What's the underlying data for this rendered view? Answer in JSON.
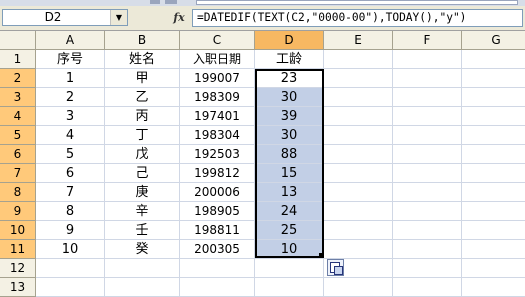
{
  "name_box": {
    "value": "D2",
    "dropdown_glyph": "▼"
  },
  "formula_bar": {
    "fx_label": "fx",
    "formula": "=DATEDIF(TEXT(C2,\"0000-00\"),TODAY(),\"y\")"
  },
  "columns": [
    "A",
    "B",
    "C",
    "D",
    "E",
    "F",
    "G"
  ],
  "header_row": [
    "序号",
    "姓名",
    "入职日期",
    "工龄"
  ],
  "rows": [
    [
      "1",
      "甲",
      "199007",
      "23"
    ],
    [
      "2",
      "乙",
      "198309",
      "30"
    ],
    [
      "3",
      "丙",
      "197401",
      "39"
    ],
    [
      "4",
      "丁",
      "198304",
      "30"
    ],
    [
      "5",
      "戊",
      "192503",
      "88"
    ],
    [
      "6",
      "己",
      "199812",
      "15"
    ],
    [
      "7",
      "庚",
      "200006",
      "13"
    ],
    [
      "8",
      "辛",
      "198905",
      "24"
    ],
    [
      "9",
      "壬",
      "198811",
      "25"
    ],
    [
      "10",
      "癸",
      "200305",
      "10"
    ]
  ],
  "row_numbers": [
    "1",
    "2",
    "3",
    "4",
    "5",
    "6",
    "7",
    "8",
    "9",
    "10",
    "11",
    "12",
    "13"
  ],
  "colors": {
    "selection_fill": "#c2cfe6",
    "selected_header": "#ffc97a",
    "header_bg": "#f4f1e4",
    "gridline": "#d0d7e5"
  },
  "icons": {
    "fx": "function-icon",
    "paste_options": "paste-options-icon",
    "dropdown": "chevron-down-icon"
  }
}
